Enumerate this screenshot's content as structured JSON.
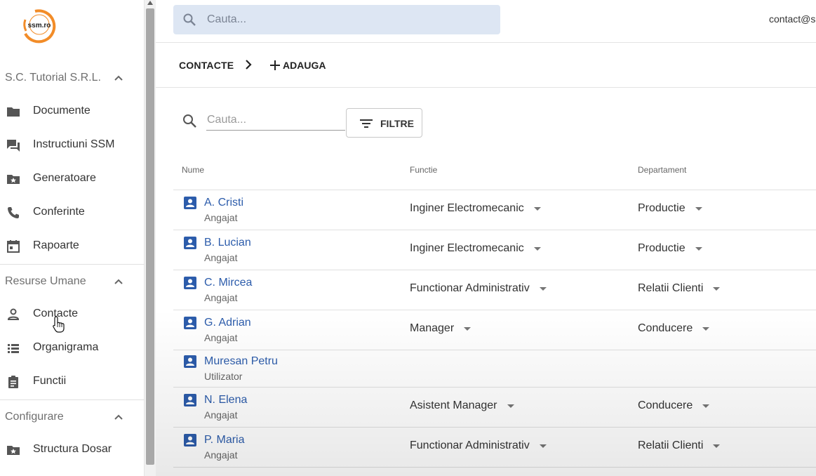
{
  "brand": {
    "logo_text": "ssm.ro",
    "accent": "#f28c28"
  },
  "sidebar": {
    "sections": [
      {
        "title": "S.C. Tutorial S.R.L.",
        "items": [
          {
            "label": "Documente",
            "icon": "folder-icon"
          },
          {
            "label": "Instructiuni SSM",
            "icon": "forum-icon"
          },
          {
            "label": "Generatoare",
            "icon": "folder-star-icon"
          },
          {
            "label": "Conferinte",
            "icon": "phone-icon"
          },
          {
            "label": "Rapoarte",
            "icon": "calendar-icon"
          }
        ]
      },
      {
        "title": "Resurse Umane",
        "items": [
          {
            "label": "Contacte",
            "icon": "person-icon"
          },
          {
            "label": "Organigrama",
            "icon": "list-icon"
          },
          {
            "label": "Functii",
            "icon": "clipboard-icon"
          }
        ]
      },
      {
        "title": "Configurare",
        "items": [
          {
            "label": "Structura Dosar",
            "icon": "folder-star-icon"
          }
        ]
      }
    ]
  },
  "topbar": {
    "search_placeholder": "Cauta...",
    "user_email": "contact@s"
  },
  "breadcrumb": {
    "title": "CONTACTE",
    "add_label": "ADAUGA"
  },
  "list": {
    "search_placeholder": "Cauta...",
    "filter_label": "FILTRE",
    "columns": [
      "Nume",
      "Functie",
      "Departament"
    ],
    "rows": [
      {
        "name": "A. Cristi",
        "role": "Angajat",
        "functie": "Inginer Electromecanic",
        "departament": "Productie"
      },
      {
        "name": "B. Lucian",
        "role": "Angajat",
        "functie": "Inginer Electromecanic",
        "departament": "Productie"
      },
      {
        "name": "C. Mircea",
        "role": "Angajat",
        "functie": "Functionar Administrativ",
        "departament": "Relatii Clienti"
      },
      {
        "name": "G. Adrian",
        "role": "Angajat",
        "functie": "Manager",
        "departament": "Conducere"
      },
      {
        "name": "Muresan Petru",
        "role": "Utilizator",
        "functie": "",
        "departament": ""
      },
      {
        "name": "N. Elena",
        "role": "Angajat",
        "functie": "Asistent Manager",
        "departament": "Conducere"
      },
      {
        "name": "P. Maria",
        "role": "Angajat",
        "functie": "Functionar Administrativ",
        "departament": "Relatii Clienti"
      }
    ]
  },
  "colors": {
    "link_blue": "#2c5cab",
    "search_bg": "#dde6f3",
    "icon_blue": "#2c5cab"
  }
}
